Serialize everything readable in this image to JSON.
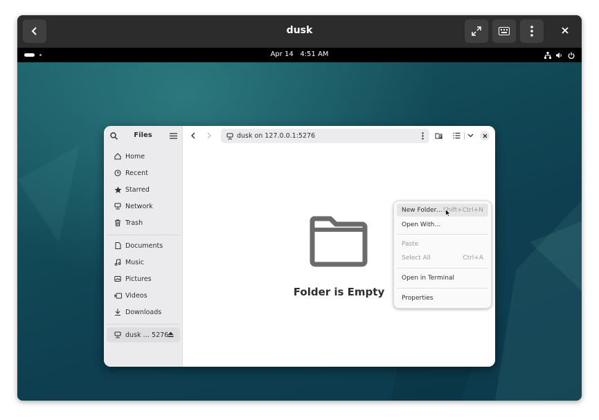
{
  "titlebar": {
    "title": "dusk",
    "back_icon": "chevron-left-icon",
    "fullscreen_icon": "expand-icon",
    "keyboard_icon": "keyboard-icon",
    "menu_icon": "vertical-dots-icon",
    "close_icon": "close-icon"
  },
  "topbar": {
    "date": "Apr 14",
    "time": "4:51 AM",
    "status_icons": [
      "network-icon",
      "volume-icon",
      "power-icon"
    ]
  },
  "sidebar": {
    "title": "Files",
    "places": [
      {
        "label": "Home",
        "icon": "home-icon"
      },
      {
        "label": "Recent",
        "icon": "clock-icon"
      },
      {
        "label": "Starred",
        "icon": "star-icon"
      },
      {
        "label": "Network",
        "icon": "network-icon"
      },
      {
        "label": "Trash",
        "icon": "trash-icon"
      }
    ],
    "bookmarks": [
      {
        "label": "Documents",
        "icon": "document-icon"
      },
      {
        "label": "Music",
        "icon": "music-icon"
      },
      {
        "label": "Pictures",
        "icon": "picture-icon"
      },
      {
        "label": "Videos",
        "icon": "video-icon"
      },
      {
        "label": "Downloads",
        "icon": "download-icon"
      }
    ],
    "mounts": [
      {
        "label": "dusk … 5276",
        "icon": "network-drive-icon",
        "eject_icon": "eject-icon"
      }
    ]
  },
  "main": {
    "path": "dusk on 127.0.0.1:5276",
    "empty_message": "Folder is Empty"
  },
  "context_menu": {
    "items": [
      {
        "label": "New Folder…",
        "shortcut": "Shift+Ctrl+N",
        "highlighted": true,
        "disabled": false
      },
      {
        "label": "Open With…",
        "shortcut": "",
        "highlighted": false,
        "disabled": false
      },
      {
        "label": "Paste",
        "shortcut": "",
        "highlighted": false,
        "disabled": true
      },
      {
        "label": "Select All",
        "shortcut": "Ctrl+A",
        "highlighted": false,
        "disabled": true
      },
      {
        "label": "Open in Terminal",
        "shortcut": "",
        "highlighted": false,
        "disabled": false
      },
      {
        "label": "Properties",
        "shortcut": "",
        "highlighted": false,
        "disabled": false
      }
    ]
  },
  "colors": {
    "accent": "#3584e4",
    "desktop_dark": "#0e3f50",
    "desktop_light": "#1c5c66"
  }
}
